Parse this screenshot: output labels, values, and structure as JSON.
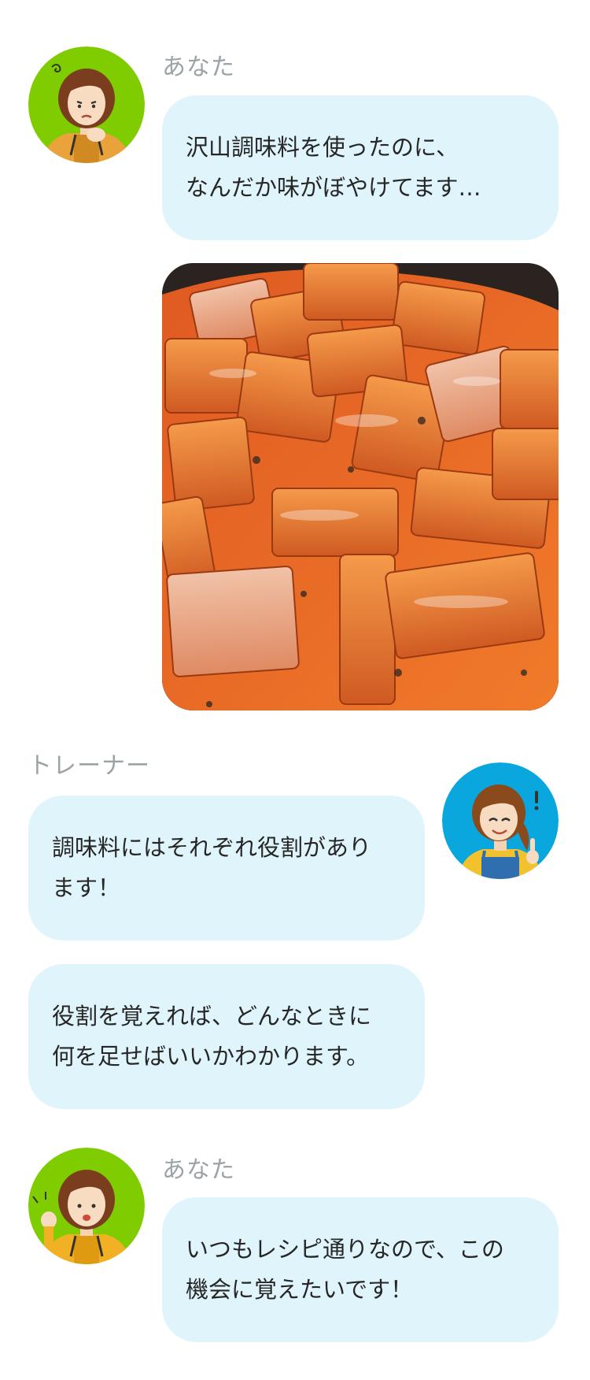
{
  "messages": [
    {
      "speaker": "あなた",
      "text": "沢山調味料を使ったのに、\nなんだか味がぼやけてます…"
    },
    {
      "speaker": "トレーナー",
      "bubbles": [
        "調味料にはそれぞれ役割があり\nます！",
        "役割を覚えれば、どんなときに\n何を足せばいいかわかります。"
      ]
    },
    {
      "speaker": "あなた",
      "text": "いつもレシピ通りなので、この\n機会に覚えたいです！"
    }
  ],
  "colors": {
    "bubble": "#e0f5fb",
    "speaker_label": "#9aa3a6",
    "user_avatar_bg": "#7fcd00",
    "trainer_avatar_bg": "#0aa6de"
  },
  "icons": {
    "user_avatar_worried": "worried-woman-avatar-icon",
    "trainer_avatar": "smiling-trainer-avatar-icon",
    "user_avatar_idea": "idea-woman-avatar-icon"
  }
}
